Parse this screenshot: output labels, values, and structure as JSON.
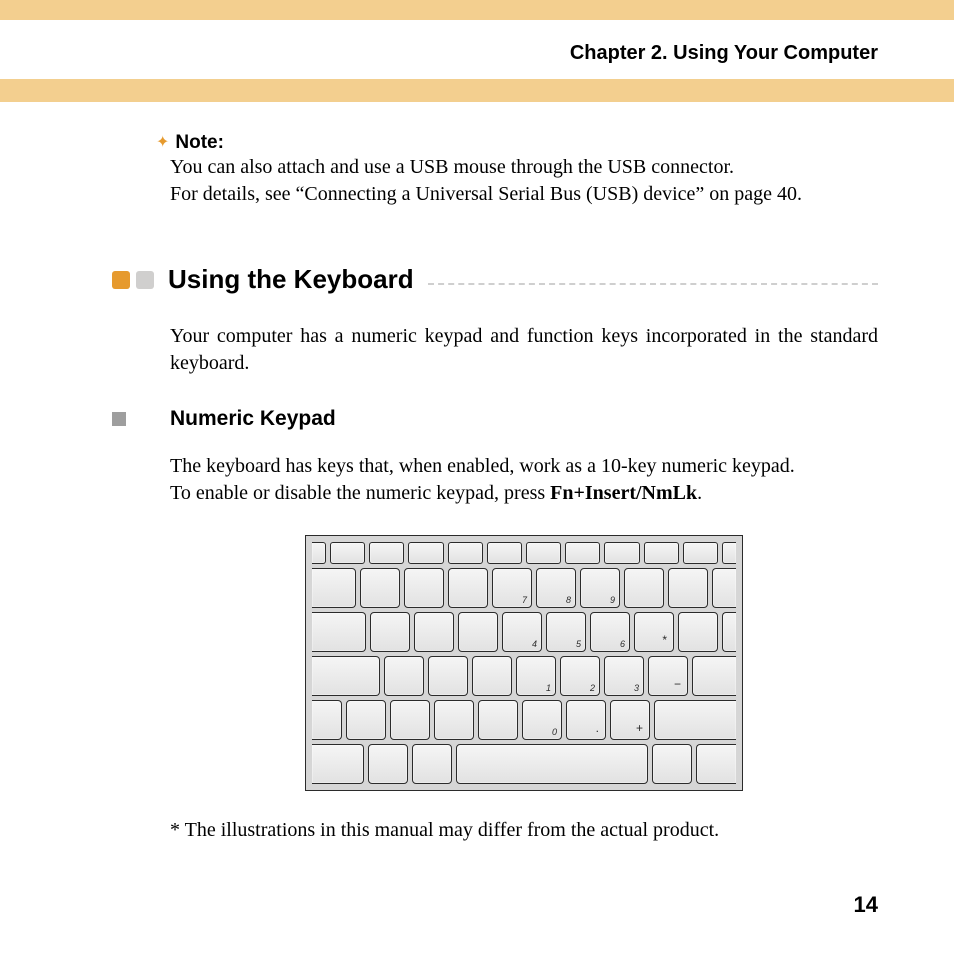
{
  "header": {
    "chapter_title": "Chapter 2. Using Your Computer"
  },
  "note": {
    "label": "Note:",
    "line1": "You can also attach and use a USB mouse through the USB connector.",
    "line2": "For details, see “Connecting a Universal Serial Bus (USB) device” on page 40."
  },
  "section": {
    "heading": "Using the Keyboard",
    "intro": "Your computer has a numeric keypad and function keys incorporated in the standard keyboard."
  },
  "subsection": {
    "heading": "Numeric Keypad",
    "para1": "The keyboard has keys that, when enabled, work as a 10-key numeric keypad.",
    "para2_prefix": "To enable or disable the numeric keypad, press ",
    "keycombo": "Fn+Insert/NmLk",
    "para2_suffix": "."
  },
  "keyboard_illustration": {
    "rows": [
      [
        "7",
        "8",
        "9",
        ""
      ],
      [
        "4",
        "5",
        "6",
        "*"
      ],
      [
        "1",
        "2",
        "3",
        "−"
      ],
      [
        "0",
        ".",
        "+"
      ]
    ]
  },
  "footnote": "* The illustrations in this manual may differ from the actual product.",
  "page_number": "14"
}
